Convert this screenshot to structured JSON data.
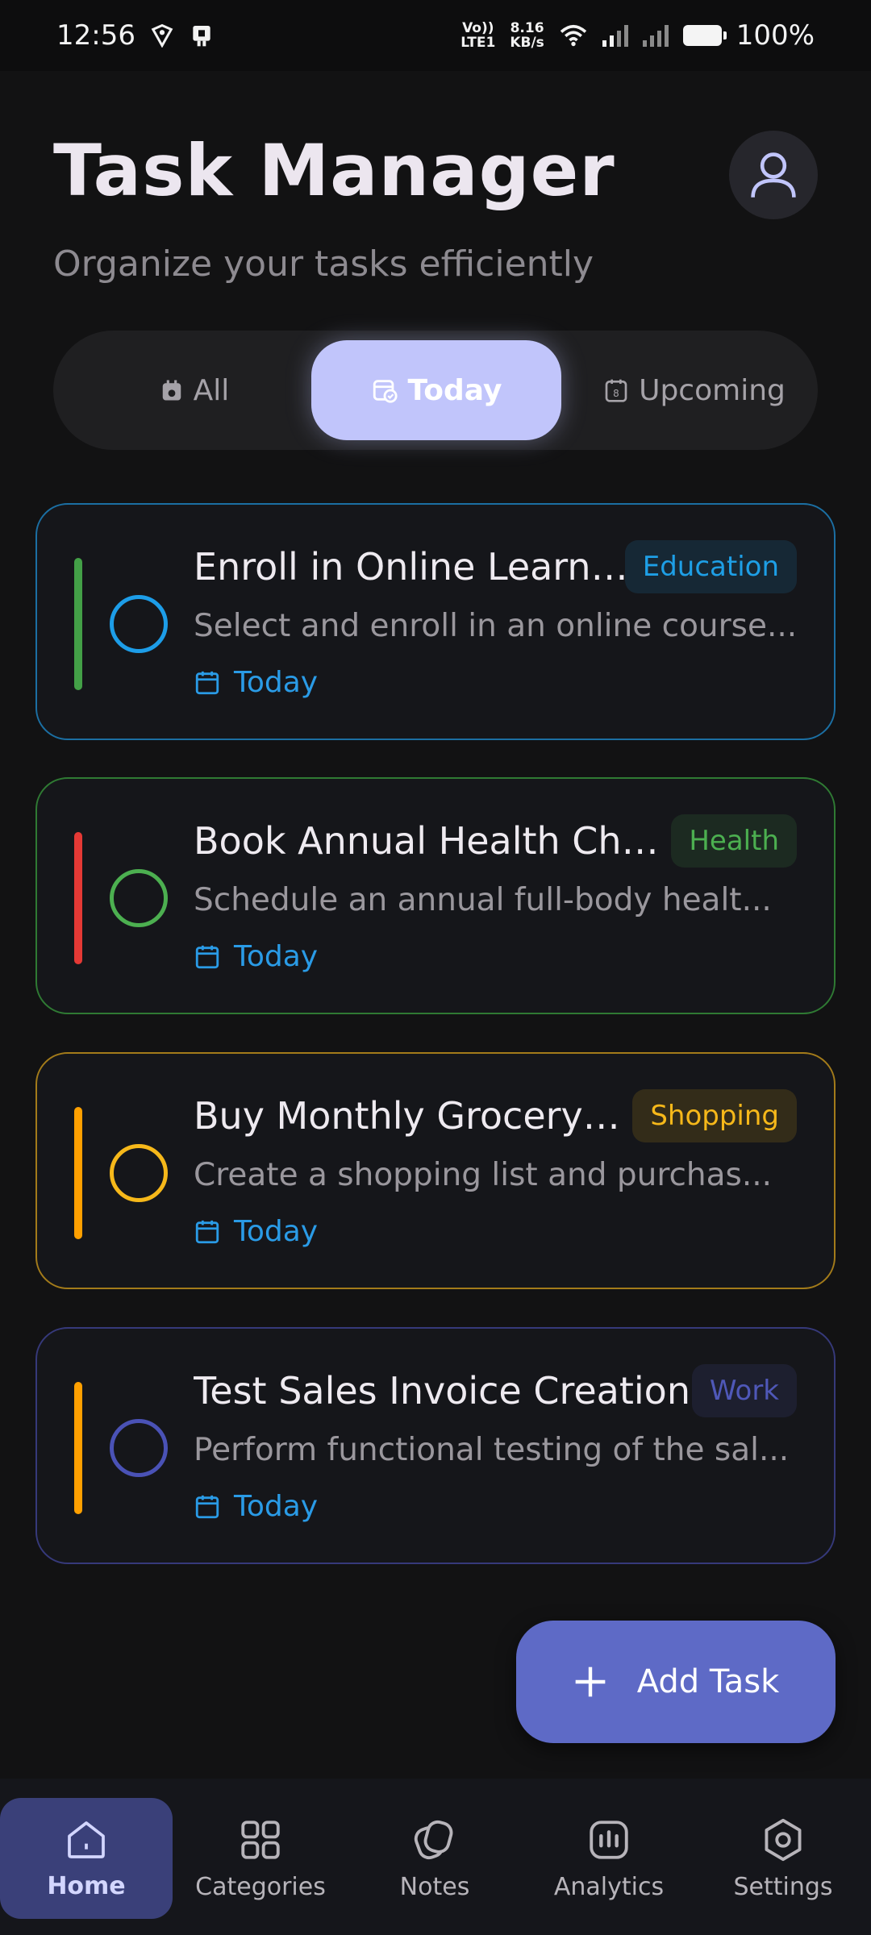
{
  "status_bar": {
    "time": "12:56",
    "net_type_line1": "Vo))",
    "net_type_line2": "LTE1",
    "speed_line1": "8.16",
    "speed_line2": "KB/s",
    "battery": "100%"
  },
  "header": {
    "title": "Task Manager",
    "subtitle": "Organize your tasks efficiently",
    "avatar_icon": "user-icon"
  },
  "tabs": [
    {
      "label": "All",
      "icon": "calendar-lock-icon",
      "active": false
    },
    {
      "label": "Today",
      "icon": "calendar-check-icon",
      "active": true
    },
    {
      "label": "Upcoming",
      "icon": "calendar-number-icon",
      "active": false
    }
  ],
  "tasks": [
    {
      "title": "Enroll in Online Learnin...",
      "description": "Select and enroll in an online course...",
      "date": "Today",
      "category": "Education",
      "category_color": "#1e9fe6",
      "border_color": "#1b6fa3",
      "priority_color": "#43a047",
      "circle_color": "#1d9de8"
    },
    {
      "title": "Book Annual Health Che...",
      "description": "Schedule an annual full-body healt...",
      "date": "Today",
      "category": "Health",
      "category_color": "#4caf50",
      "border_color": "#2f7a33",
      "priority_color": "#e53935",
      "circle_color": "#4caf50"
    },
    {
      "title": "Buy Monthly Grocery E...",
      "description": "Create a shopping list and purchas...",
      "date": "Today",
      "category": "Shopping",
      "category_color": "#f6b81a",
      "border_color": "#a37b1a",
      "priority_color": "#ffa000",
      "circle_color": "#f6b81a"
    },
    {
      "title": "Test Sales Invoice Creation",
      "description": "Perform functional testing of the sal...",
      "date": "Today",
      "category": "Work",
      "category_color": "#4f58b8",
      "border_color": "#36397a",
      "priority_color": "#ffa000",
      "circle_color": "#4a52b6"
    }
  ],
  "fab": {
    "label": "Add Task",
    "icon": "plus-icon"
  },
  "bottom_nav": [
    {
      "label": "Home",
      "icon": "home-icon",
      "active": true
    },
    {
      "label": "Categories",
      "icon": "grid-icon",
      "active": false
    },
    {
      "label": "Notes",
      "icon": "notes-icon",
      "active": false
    },
    {
      "label": "Analytics",
      "icon": "analytics-icon",
      "active": false
    },
    {
      "label": "Settings",
      "icon": "settings-icon",
      "active": false
    }
  ]
}
